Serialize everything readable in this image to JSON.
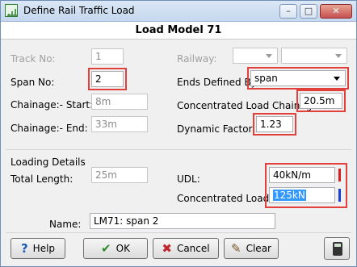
{
  "window": {
    "title": "Define Rail Traffic Load"
  },
  "header": {
    "title": "Load Model 71"
  },
  "form": {
    "track_no": {
      "label": "Track No:",
      "value": "1"
    },
    "railway": {
      "label": "Railway:"
    },
    "span_no": {
      "label": "Span No:",
      "value": "2"
    },
    "ends_defined_by": {
      "label": "Ends Defined By:",
      "value": "span"
    },
    "chainage_start": {
      "label": "Chainage:- Start:",
      "value": "8m"
    },
    "concentrated_load_chainage": {
      "label": "Concentrated Load Chainage:",
      "value": "20.5m"
    },
    "chainage_end": {
      "label": "Chainage:- End:",
      "value": "33m"
    },
    "dynamic_factor": {
      "label": "Dynamic Factor, Φ:",
      "value": "1.23"
    }
  },
  "loading_details": {
    "section_label": "Loading Details",
    "total_length": {
      "label": "Total Length:",
      "value": "25m"
    },
    "udl": {
      "label": "UDL:",
      "value": "40kN/m",
      "indicator_color": "#d62020"
    },
    "concentrated_load": {
      "label": "Concentrated Load:",
      "value": "125kN",
      "indicator_color": "#1a3fd6"
    }
  },
  "name_field": {
    "label": "Name:",
    "value": "LM71: span 2"
  },
  "buttons": {
    "help": "Help",
    "ok": "OK",
    "cancel": "Cancel",
    "clear": "Clear"
  },
  "icons": {
    "help": "?",
    "ok": "✔",
    "cancel": "✖",
    "clear": "✎",
    "minimize": "–",
    "maximize": "□",
    "close": "✕"
  },
  "colors": {
    "highlight_box": "#e2413b",
    "selection": "#3399ff"
  }
}
